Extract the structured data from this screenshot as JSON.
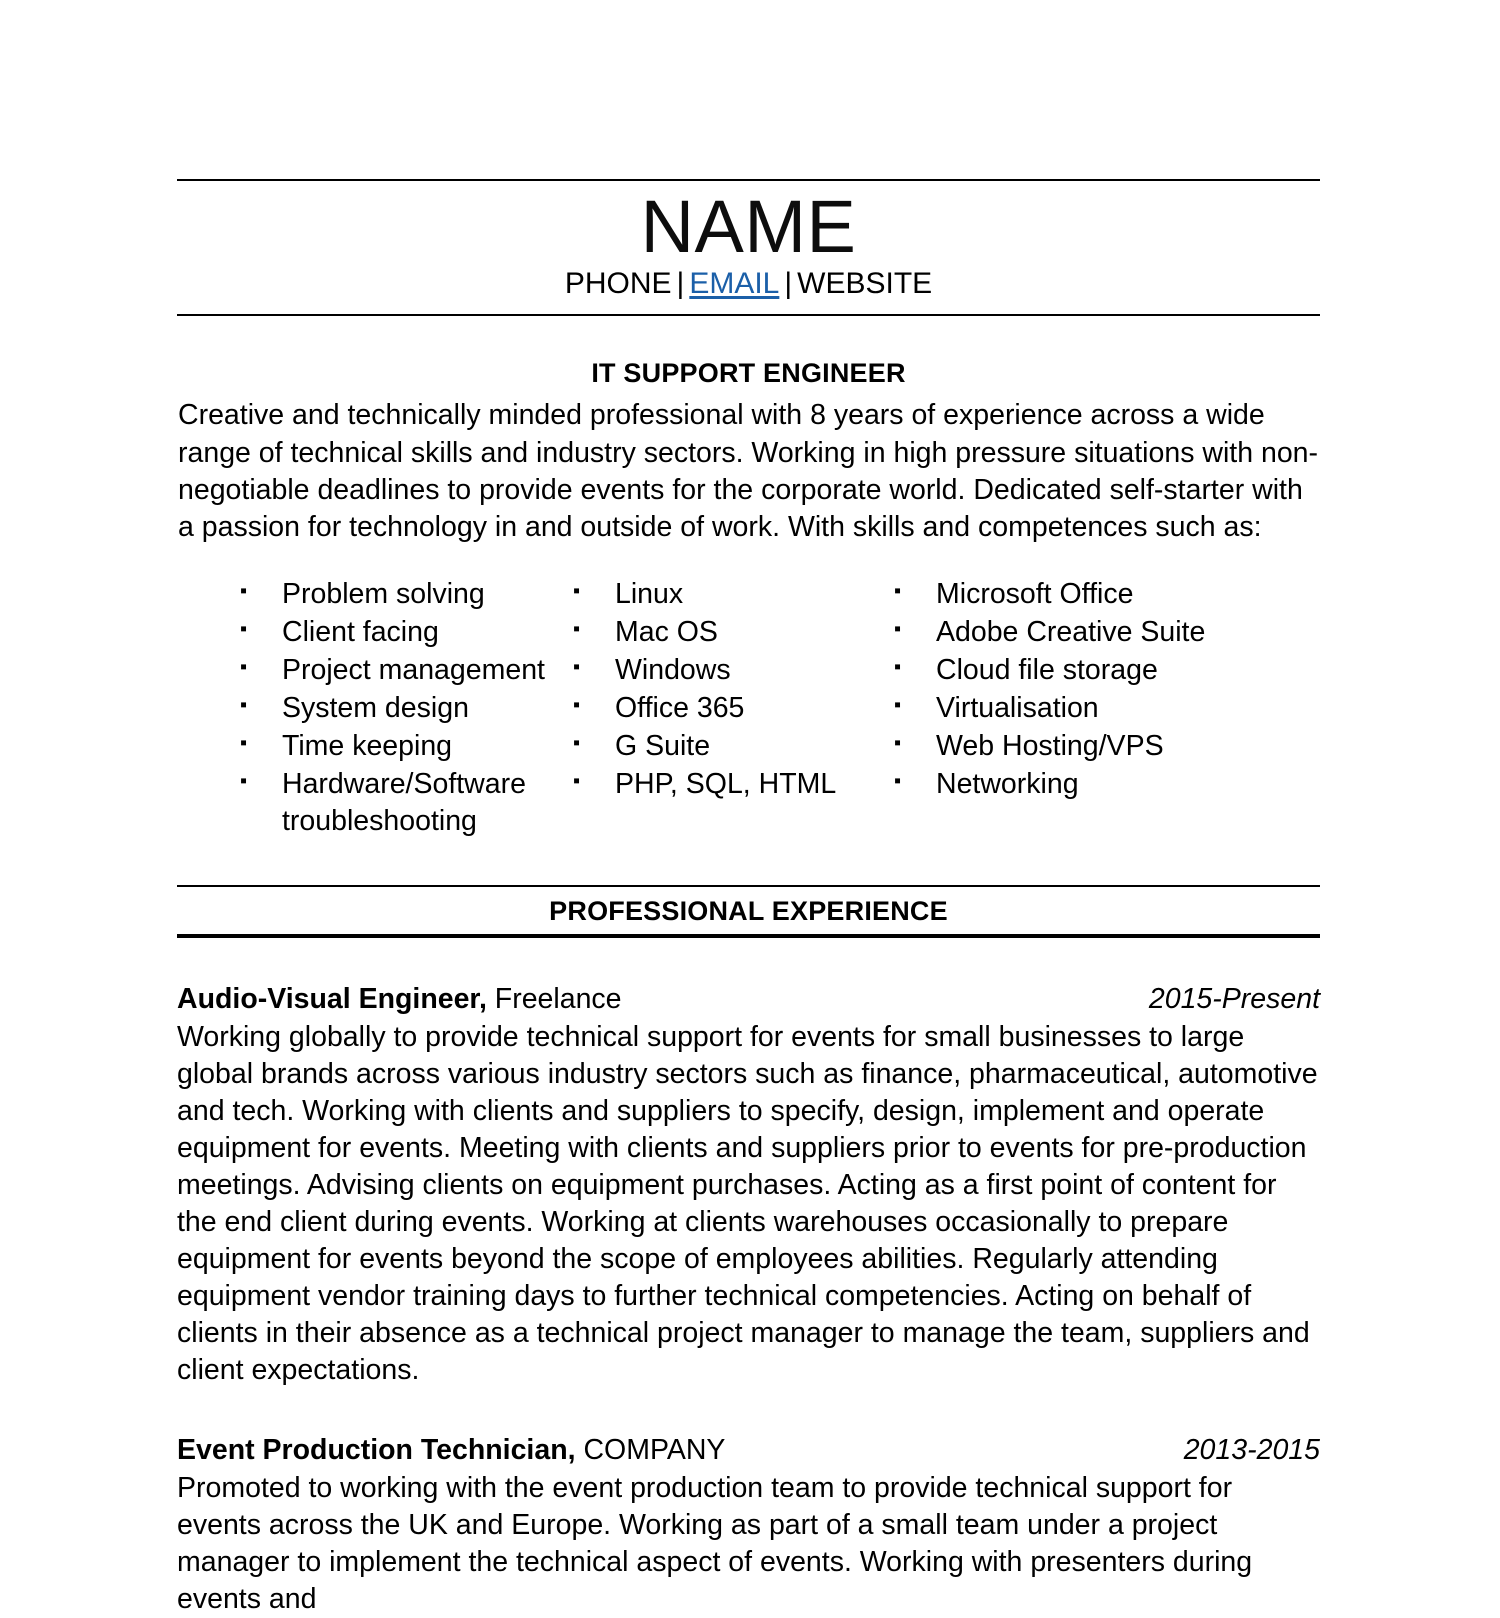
{
  "header": {
    "name": "NAME",
    "contact": {
      "phone": "PHONE",
      "email": "EMAIL",
      "website": "WEBSITE",
      "separator": "|"
    },
    "link_color": "#1B5FA8"
  },
  "summary": {
    "title": "IT SUPPORT ENGINEER",
    "text": "Creative and technically minded professional with 8 years of experience across a wide range of technical skills and industry sectors. Working in high pressure situations with non-negotiable deadlines to provide events for the corporate world. Dedicated self-starter with a passion for technology in and outside of work. With skills and competences such as:"
  },
  "skills": {
    "bullet": "▪",
    "columns": [
      {
        "items": [
          "Problem solving",
          "Client facing",
          "Project management",
          "System design",
          "Time keeping",
          "Hardware/Software troubleshooting"
        ]
      },
      {
        "items": [
          "Linux",
          "Mac OS",
          "Windows",
          "Office 365",
          "G Suite",
          "PHP, SQL, HTML"
        ]
      },
      {
        "items": [
          "Microsoft Office",
          "Adobe Creative Suite",
          "Cloud file storage",
          "Virtualisation",
          "Web Hosting/VPS",
          "Networking"
        ]
      }
    ]
  },
  "experience": {
    "section_title": "PROFESSIONAL EXPERIENCE",
    "jobs": [
      {
        "role": "Audio-Visual Engineer,",
        "company": "Freelance",
        "dates": "2015-Present",
        "description": "Working globally to provide technical support for events for small businesses to large global brands across various industry sectors such as finance, pharmaceutical, automotive and tech. Working with clients and suppliers to specify, design, implement and operate equipment for events. Meeting with clients and suppliers prior to events for pre-production meetings. Advising clients on equipment purchases. Acting as a first point of content for the end client during events. Working at clients warehouses occasionally to prepare equipment for events beyond the scope of employees abilities. Regularly attending equipment vendor training days to further technical competencies. Acting on behalf of clients in their absence as a technical project manager to manage the team, suppliers and client expectations."
      },
      {
        "role": "Event Production Technician,",
        "company": "COMPANY",
        "dates": "2013-2015",
        "description": "Promoted to working with the event production team to provide technical support for events across the UK and Europe. Working as part of a small team under a project manager to implement the technical aspect of events. Working with presenters during events and"
      }
    ]
  }
}
